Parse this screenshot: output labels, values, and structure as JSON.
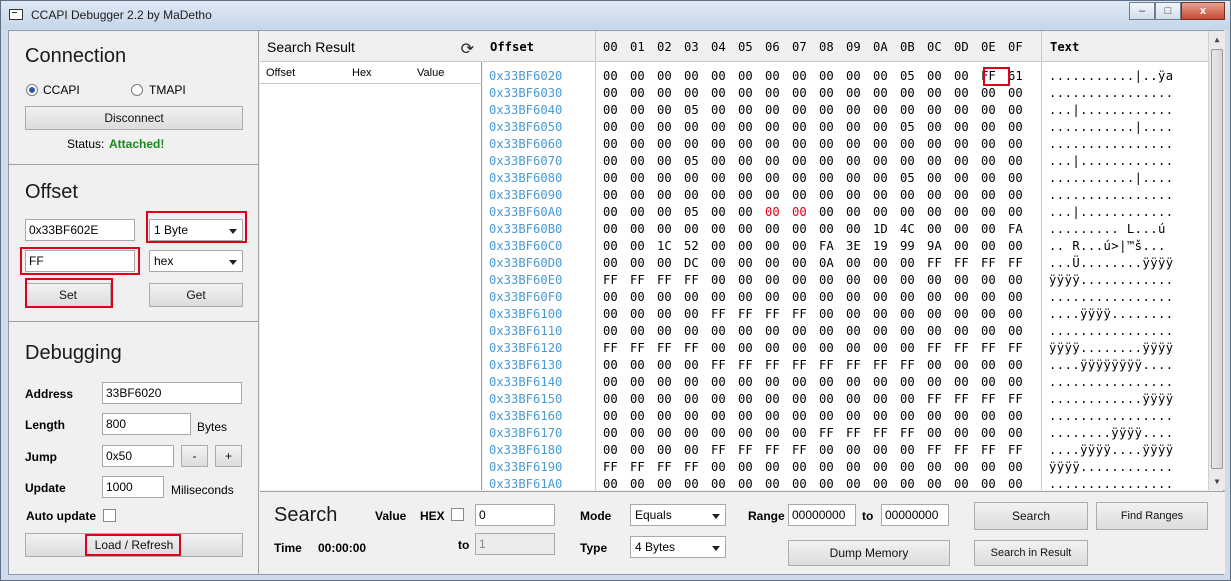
{
  "window": {
    "title": "CCAPI Debugger 2.2 by MaDetho",
    "min": "‒",
    "max": "□",
    "close": "x"
  },
  "connection": {
    "heading": "Connection",
    "ccapi_label": "CCAPI",
    "tmapi_label": "TMAPI",
    "disconnect_label": "Disconnect",
    "status_label": "Status:",
    "status_value": "Attached!",
    "status_color": "#1a8a1a"
  },
  "offset": {
    "heading": "Offset",
    "address_value": "0x33BF602E",
    "size_selected": "1 Byte",
    "value": "FF",
    "format_selected": "hex",
    "set_label": "Set",
    "get_label": "Get"
  },
  "debugging": {
    "heading": "Debugging",
    "address_label": "Address",
    "address_value": "33BF6020",
    "length_label": "Length",
    "length_value": "800",
    "length_unit": "Bytes",
    "jump_label": "Jump",
    "jump_value": "0x50",
    "minus_label": "-",
    "plus_label": "+",
    "update_label": "Update",
    "update_value": "1000",
    "update_unit": "Miliseconds",
    "auto_update_label": "Auto update",
    "load_label": "Load / Refresh"
  },
  "search_result": {
    "title": "Search Result",
    "columns": [
      "Offset",
      "Hex",
      "Value"
    ]
  },
  "hex_view": {
    "offset_header": "Offset",
    "col_headers": [
      "00",
      "01",
      "02",
      "03",
      "04",
      "05",
      "06",
      "07",
      "08",
      "09",
      "0A",
      "0B",
      "0C",
      "0D",
      "0E",
      "0F"
    ],
    "text_header": "Text",
    "accent": "#4a9ad4",
    "rows": [
      {
        "off": "0x33BF6020",
        "bytes": [
          "00",
          "00",
          "00",
          "00",
          "00",
          "00",
          "00",
          "00",
          "00",
          "00",
          "00",
          "05",
          "00",
          "00",
          "FF",
          "61"
        ],
        "text": "...........|..ÿa"
      },
      {
        "off": "0x33BF6030",
        "bytes": [
          "00",
          "00",
          "00",
          "00",
          "00",
          "00",
          "00",
          "00",
          "00",
          "00",
          "00",
          "00",
          "00",
          "00",
          "00",
          "00"
        ],
        "text": "................"
      },
      {
        "off": "0x33BF6040",
        "bytes": [
          "00",
          "00",
          "00",
          "05",
          "00",
          "00",
          "00",
          "00",
          "00",
          "00",
          "00",
          "00",
          "00",
          "00",
          "00",
          "00"
        ],
        "text": "...|............"
      },
      {
        "off": "0x33BF6050",
        "bytes": [
          "00",
          "00",
          "00",
          "00",
          "00",
          "00",
          "00",
          "00",
          "00",
          "00",
          "00",
          "05",
          "00",
          "00",
          "00",
          "00"
        ],
        "text": "...........|...."
      },
      {
        "off": "0x33BF6060",
        "bytes": [
          "00",
          "00",
          "00",
          "00",
          "00",
          "00",
          "00",
          "00",
          "00",
          "00",
          "00",
          "00",
          "00",
          "00",
          "00",
          "00"
        ],
        "text": "................"
      },
      {
        "off": "0x33BF6070",
        "bytes": [
          "00",
          "00",
          "00",
          "05",
          "00",
          "00",
          "00",
          "00",
          "00",
          "00",
          "00",
          "00",
          "00",
          "00",
          "00",
          "00"
        ],
        "text": "...|............"
      },
      {
        "off": "0x33BF6080",
        "bytes": [
          "00",
          "00",
          "00",
          "00",
          "00",
          "00",
          "00",
          "00",
          "00",
          "00",
          "00",
          "05",
          "00",
          "00",
          "00",
          "00"
        ],
        "text": "...........|...."
      },
      {
        "off": "0x33BF6090",
        "bytes": [
          "00",
          "00",
          "00",
          "00",
          "00",
          "00",
          "00",
          "00",
          "00",
          "00",
          "00",
          "00",
          "00",
          "00",
          "00",
          "00"
        ],
        "text": "................"
      },
      {
        "off": "0x33BF60A0",
        "bytes": [
          "00",
          "00",
          "00",
          "05",
          "00",
          "00",
          "00",
          "00",
          "00",
          "00",
          "00",
          "00",
          "00",
          "00",
          "00",
          "00"
        ],
        "text": "...|............",
        "red": [
          6,
          7
        ]
      },
      {
        "off": "0x33BF60B0",
        "bytes": [
          "00",
          "00",
          "00",
          "00",
          "00",
          "00",
          "00",
          "00",
          "00",
          "00",
          "1D",
          "4C",
          "00",
          "00",
          "00",
          "FA"
        ],
        "text": "......... L...ú"
      },
      {
        "off": "0x33BF60C0",
        "bytes": [
          "00",
          "00",
          "1C",
          "52",
          "00",
          "00",
          "00",
          "00",
          "FA",
          "3E",
          "19",
          "99",
          "9A",
          "00",
          "00",
          "00"
        ],
        "text": ".. R...ú>|™š..."
      },
      {
        "off": "0x33BF60D0",
        "bytes": [
          "00",
          "00",
          "00",
          "DC",
          "00",
          "00",
          "00",
          "00",
          "0A",
          "00",
          "00",
          "00",
          "FF",
          "FF",
          "FF",
          "FF"
        ],
        "text": "...Ü........ÿÿÿÿ"
      },
      {
        "off": "0x33BF60E0",
        "bytes": [
          "FF",
          "FF",
          "FF",
          "FF",
          "00",
          "00",
          "00",
          "00",
          "00",
          "00",
          "00",
          "00",
          "00",
          "00",
          "00",
          "00"
        ],
        "text": "ÿÿÿÿ............"
      },
      {
        "off": "0x33BF60F0",
        "bytes": [
          "00",
          "00",
          "00",
          "00",
          "00",
          "00",
          "00",
          "00",
          "00",
          "00",
          "00",
          "00",
          "00",
          "00",
          "00",
          "00"
        ],
        "text": "................"
      },
      {
        "off": "0x33BF6100",
        "bytes": [
          "00",
          "00",
          "00",
          "00",
          "FF",
          "FF",
          "FF",
          "FF",
          "00",
          "00",
          "00",
          "00",
          "00",
          "00",
          "00",
          "00"
        ],
        "text": "....ÿÿÿÿ........"
      },
      {
        "off": "0x33BF6110",
        "bytes": [
          "00",
          "00",
          "00",
          "00",
          "00",
          "00",
          "00",
          "00",
          "00",
          "00",
          "00",
          "00",
          "00",
          "00",
          "00",
          "00"
        ],
        "text": "................"
      },
      {
        "off": "0x33BF6120",
        "bytes": [
          "FF",
          "FF",
          "FF",
          "FF",
          "00",
          "00",
          "00",
          "00",
          "00",
          "00",
          "00",
          "00",
          "FF",
          "FF",
          "FF",
          "FF"
        ],
        "text": "ÿÿÿÿ........ÿÿÿÿ"
      },
      {
        "off": "0x33BF6130",
        "bytes": [
          "00",
          "00",
          "00",
          "00",
          "FF",
          "FF",
          "FF",
          "FF",
          "FF",
          "FF",
          "FF",
          "FF",
          "00",
          "00",
          "00",
          "00"
        ],
        "text": "....ÿÿÿÿÿÿÿÿ...."
      },
      {
        "off": "0x33BF6140",
        "bytes": [
          "00",
          "00",
          "00",
          "00",
          "00",
          "00",
          "00",
          "00",
          "00",
          "00",
          "00",
          "00",
          "00",
          "00",
          "00",
          "00"
        ],
        "text": "................"
      },
      {
        "off": "0x33BF6150",
        "bytes": [
          "00",
          "00",
          "00",
          "00",
          "00",
          "00",
          "00",
          "00",
          "00",
          "00",
          "00",
          "00",
          "FF",
          "FF",
          "FF",
          "FF"
        ],
        "text": "............ÿÿÿÿ"
      },
      {
        "off": "0x33BF6160",
        "bytes": [
          "00",
          "00",
          "00",
          "00",
          "00",
          "00",
          "00",
          "00",
          "00",
          "00",
          "00",
          "00",
          "00",
          "00",
          "00",
          "00"
        ],
        "text": "................"
      },
      {
        "off": "0x33BF6170",
        "bytes": [
          "00",
          "00",
          "00",
          "00",
          "00",
          "00",
          "00",
          "00",
          "FF",
          "FF",
          "FF",
          "FF",
          "00",
          "00",
          "00",
          "00"
        ],
        "text": "........ÿÿÿÿ...."
      },
      {
        "off": "0x33BF6180",
        "bytes": [
          "00",
          "00",
          "00",
          "00",
          "FF",
          "FF",
          "FF",
          "FF",
          "00",
          "00",
          "00",
          "00",
          "FF",
          "FF",
          "FF",
          "FF"
        ],
        "text": "....ÿÿÿÿ....ÿÿÿÿ"
      },
      {
        "off": "0x33BF6190",
        "bytes": [
          "FF",
          "FF",
          "FF",
          "FF",
          "00",
          "00",
          "00",
          "00",
          "00",
          "00",
          "00",
          "00",
          "00",
          "00",
          "00",
          "00"
        ],
        "text": "ÿÿÿÿ............"
      },
      {
        "off": "0x33BF61A0",
        "bytes": [
          "00",
          "00",
          "00",
          "00",
          "00",
          "00",
          "00",
          "00",
          "00",
          "00",
          "00",
          "00",
          "00",
          "00",
          "00",
          "00"
        ],
        "text": "................"
      }
    ]
  },
  "search": {
    "heading": "Search",
    "value_label": "Value",
    "hex_label": "HEX",
    "value_input": "0",
    "to_label": "to",
    "to_input": "1",
    "time_label": "Time",
    "time_value": "00:00:00",
    "mode_label": "Mode",
    "mode_selected": "Equals",
    "type_label": "Type",
    "type_selected": "4 Bytes",
    "range_label": "Range",
    "range_from": "00000000",
    "range_to_label": "to",
    "range_to": "00000000",
    "search_label": "Search",
    "find_ranges_label": "Find Ranges",
    "dump_label": "Dump Memory",
    "search_in_result_label": "Search in Result"
  }
}
